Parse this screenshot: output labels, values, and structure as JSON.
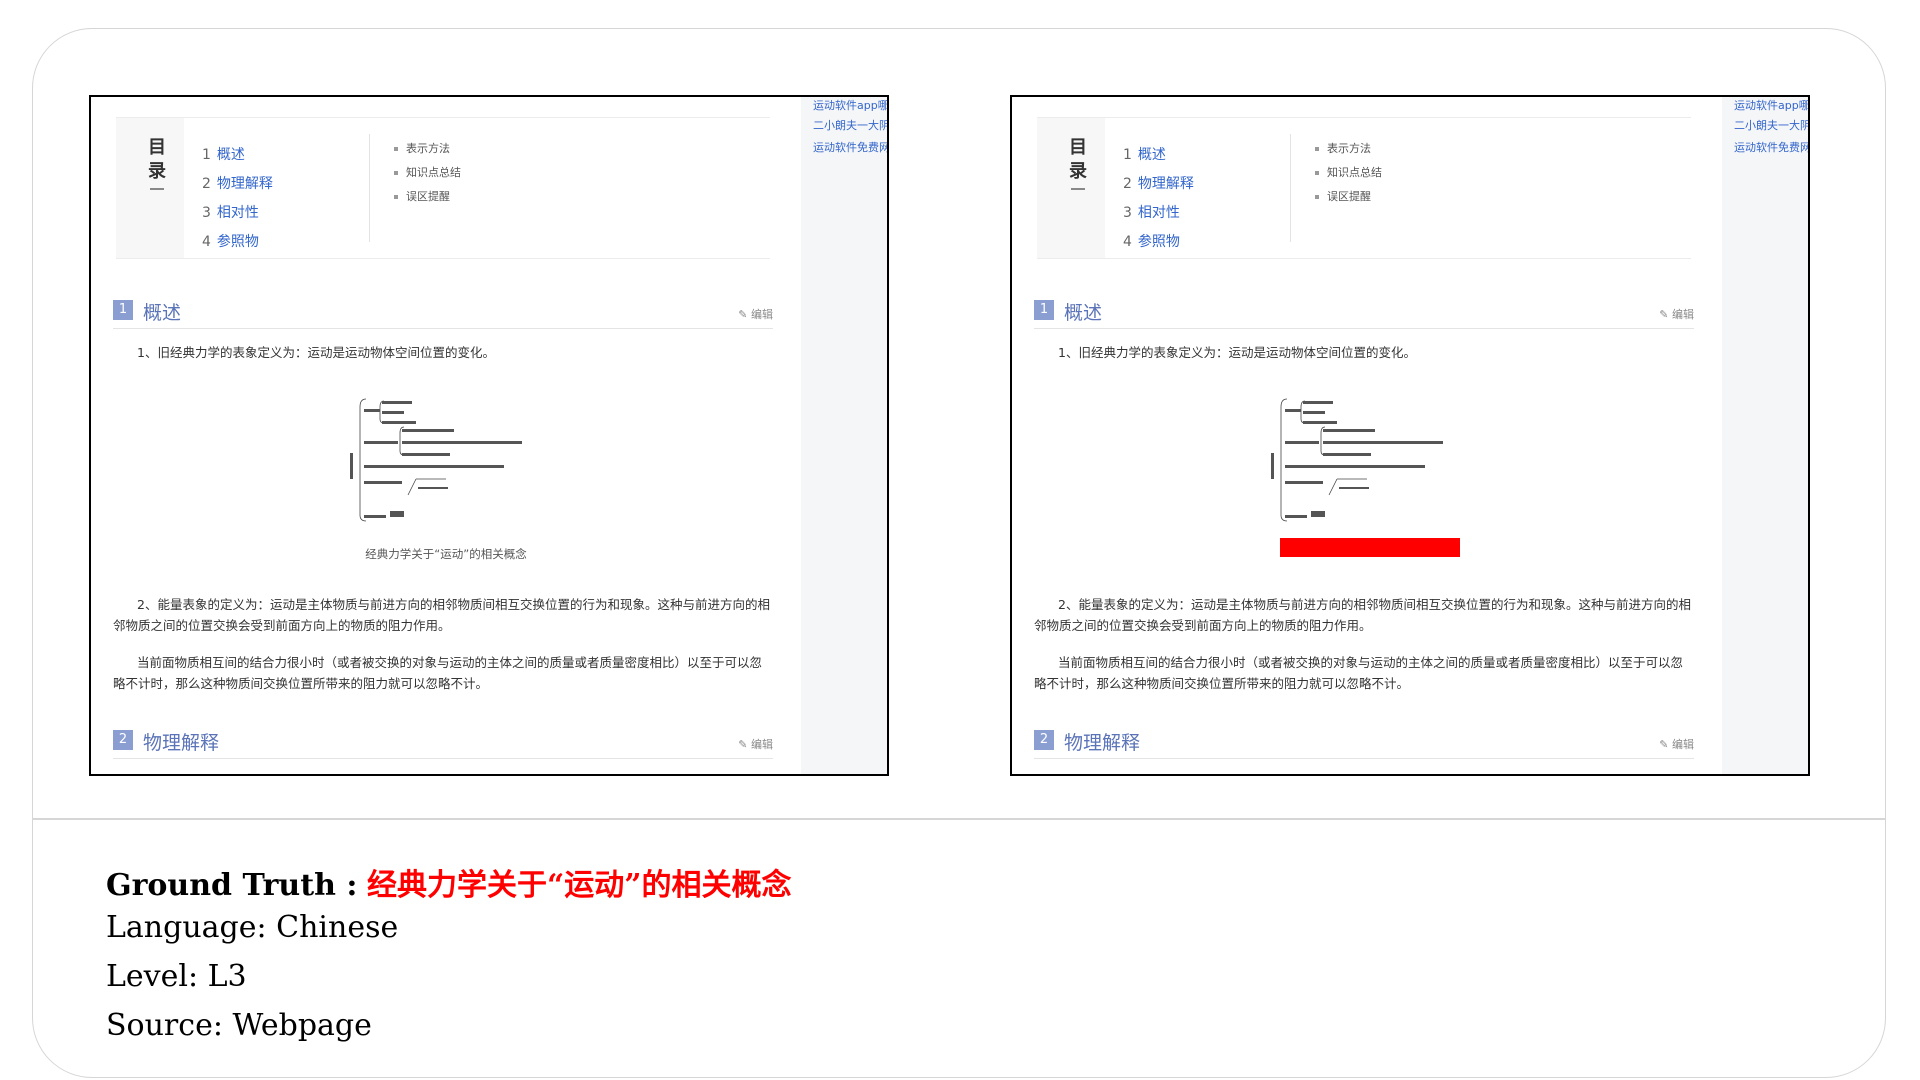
{
  "panels": [
    {
      "right_links": [
        "运动软件app哪",
        "二小朗夫一大阴",
        "运动软件免费网"
      ],
      "toc": {
        "title": "目录",
        "items": [
          {
            "num": "1",
            "label": "概述"
          },
          {
            "num": "2",
            "label": "物理解释"
          },
          {
            "num": "3",
            "label": "相对性"
          },
          {
            "num": "4",
            "label": "参照物"
          }
        ],
        "subs": [
          "表示方法",
          "知识点总结",
          "误区提醒"
        ]
      },
      "section1": {
        "num": "1",
        "title": "概述",
        "edit": "编辑"
      },
      "para1": "1、旧经典力学的表象定义为：运动是运动物体空间位置的变化。",
      "figure_caption": "经典力学关于“运动”的相关概念",
      "caption_masked": false,
      "para2": "2、能量表象的定义为：运动是主体物质与前进方向的相邻物质间相互交换位置的行为和现象。这种与前进方向的相邻物质之间的位置交换会受到前面方向上的物质的阻力作用。",
      "para3": "当前面物质相互间的结合力很小时（或者被交换的对象与运动的主体之间的质量或者质量密度相比）以至于可以忽略不计时，那么这种物质间交换位置所带来的阻力就可以忽略不计。",
      "section2": {
        "num": "2",
        "title": "物理解释",
        "edit": "编辑"
      }
    },
    {
      "right_links": [
        "运动软件app哪",
        "二小朗夫一大阴",
        "运动软件免费网"
      ],
      "toc": {
        "title": "目录",
        "items": [
          {
            "num": "1",
            "label": "概述"
          },
          {
            "num": "2",
            "label": "物理解释"
          },
          {
            "num": "3",
            "label": "相对性"
          },
          {
            "num": "4",
            "label": "参照物"
          }
        ],
        "subs": [
          "表示方法",
          "知识点总结",
          "误区提醒"
        ]
      },
      "section1": {
        "num": "1",
        "title": "概述",
        "edit": "编辑"
      },
      "para1": "1、旧经典力学的表象定义为：运动是运动物体空间位置的变化。",
      "figure_caption": "",
      "caption_masked": true,
      "para2": "2、能量表象的定义为：运动是主体物质与前进方向的相邻物质间相互交换位置的行为和现象。这种与前进方向的相邻物质之间的位置交换会受到前面方向上的物质的阻力作用。",
      "para3": "当前面物质相互间的结合力很小时（或者被交换的对象与运动的主体之间的质量或者质量密度相比）以至于可以忽略不计时，那么这种物质间交换位置所带来的阻力就可以忽略不计。",
      "section2": {
        "num": "2",
        "title": "物理解释",
        "edit": "编辑"
      }
    }
  ],
  "meta": {
    "ground_truth_label": "Ground Truth :",
    "ground_truth_value": "经典力学关于“运动”的相关概念",
    "language": "Language: Chinese",
    "level": "Level: L3",
    "source": "Source: Webpage"
  },
  "colors": {
    "link": "#3366cc",
    "section": "#5b74b8",
    "mask": "#ff0000"
  }
}
